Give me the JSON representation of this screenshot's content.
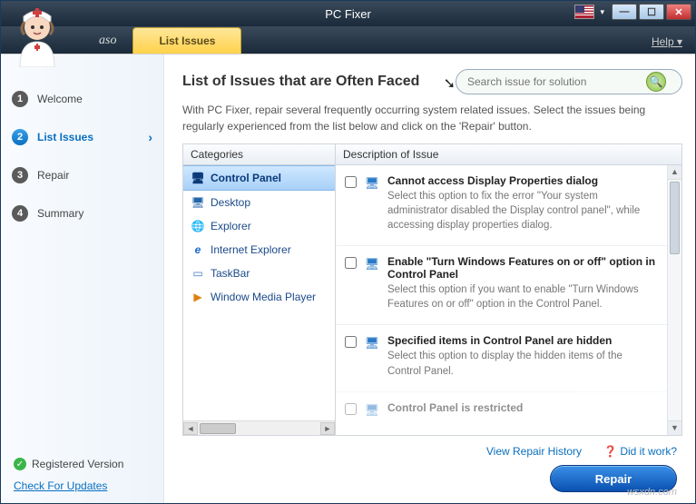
{
  "window": {
    "title": "PC Fixer"
  },
  "menubar": {
    "tab1": "aso",
    "tab2": "List Issues",
    "help": "Help"
  },
  "sidebar": {
    "steps": [
      {
        "num": "1",
        "label": "Welcome"
      },
      {
        "num": "2",
        "label": "List Issues"
      },
      {
        "num": "3",
        "label": "Repair"
      },
      {
        "num": "4",
        "label": "Summary"
      }
    ],
    "registered": "Registered Version",
    "updates": "Check For Updates"
  },
  "main": {
    "heading": "List of Issues that are Often Faced",
    "search_placeholder": "Search issue for solution",
    "description": "With PC Fixer, repair several frequently occurring system related issues. Select the issues being regularly experienced from the list below and click on the 'Repair' button.",
    "categories_header": "Categories",
    "issues_header": "Description of Issue",
    "categories": [
      {
        "label": "Control Panel",
        "icon": "🖥"
      },
      {
        "label": "Desktop",
        "icon": "🖥"
      },
      {
        "label": "Explorer",
        "icon": "🌐"
      },
      {
        "label": "Internet Explorer",
        "icon": "e"
      },
      {
        "label": "TaskBar",
        "icon": "▭"
      },
      {
        "label": "Window Media Player",
        "icon": "▶"
      }
    ],
    "issues": [
      {
        "title": "Cannot access Display Properties dialog",
        "desc": "Select this option to fix the error \"Your system administrator disabled the Display control panel\", while accessing display properties dialog."
      },
      {
        "title": "Enable \"Turn Windows Features on or off\" option in Control Panel",
        "desc": "Select this option if you want to enable \"Turn Windows Features on or off\" option in the Control Panel."
      },
      {
        "title": "Specified items in Control Panel are hidden",
        "desc": "Select this option to display the hidden items of the Control Panel."
      },
      {
        "title": "Control Panel is restricted",
        "desc": ""
      }
    ],
    "history_link": "View Repair History",
    "didwork_link": "Did it work?",
    "repair_btn": "Repair"
  },
  "watermark": "wsxdn.com"
}
